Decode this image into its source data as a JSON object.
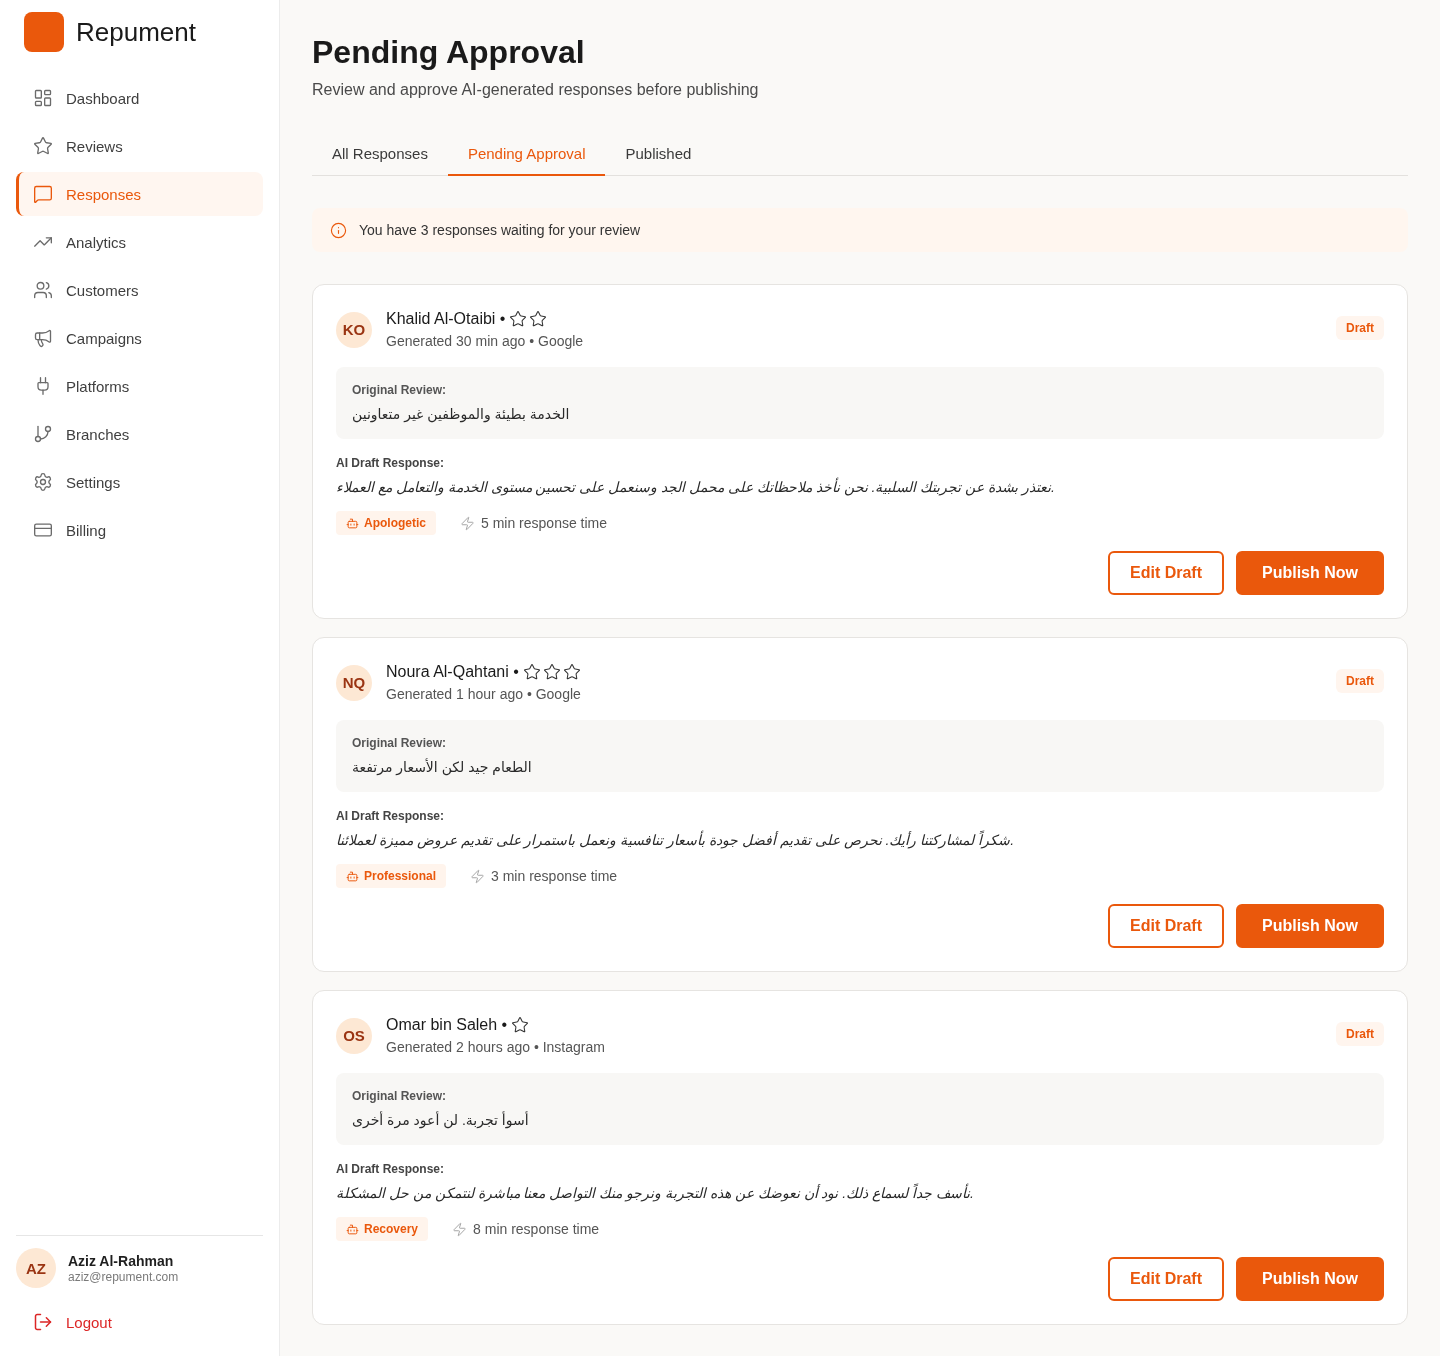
{
  "sidebar": {
    "brand": "Repument",
    "nav": [
      {
        "label": "Dashboard",
        "selected": false
      },
      {
        "label": "Reviews",
        "selected": false
      },
      {
        "label": "Responses",
        "selected": true
      },
      {
        "label": "Analytics",
        "selected": false
      },
      {
        "label": "Customers",
        "selected": false
      },
      {
        "label": "Campaigns",
        "selected": false
      },
      {
        "label": "Platforms",
        "selected": false
      },
      {
        "label": "Branches",
        "selected": false
      },
      {
        "label": "Settings",
        "selected": false
      },
      {
        "label": "Billing",
        "selected": false
      }
    ],
    "user": {
      "initials": "AZ",
      "name": "Aziz Al-Rahman",
      "email": "aziz@repument.com"
    },
    "logout": "Logout"
  },
  "page": {
    "title": "Pending Approval",
    "subtitle": "Review and approve AI-generated responses before publishing"
  },
  "tabs": [
    {
      "label": "All Responses",
      "selected": false
    },
    {
      "label": "Pending Approval",
      "selected": true
    },
    {
      "label": "Published",
      "selected": false
    }
  ],
  "notice": "You have 3 responses waiting for your review",
  "cards": [
    {
      "initials": "KO",
      "name": "Khalid Al-Otaibi •",
      "rating_stars": [
        {
          "filled": false
        },
        {
          "filled": false
        }
      ],
      "meta": "Generated 30 min ago • Google",
      "status": "Draft",
      "original_label": "Original Review:",
      "original": "الخدمة بطيئة والموظفين غير متعاونين",
      "draft_label": "AI Draft Response:",
      "draft": "نعتذر بشدة عن تجربتك السلبية. نحن نأخذ ملاحظاتك على محمل الجد وسنعمل على تحسين مستوى الخدمة والتعامل مع العملاء.",
      "tone": "Apologetic",
      "response_time": "5 min response time",
      "actions": [
        {
          "label": "Edit Draft",
          "kind": "outline"
        },
        {
          "label": "Publish Now",
          "kind": "primary"
        }
      ]
    },
    {
      "initials": "NQ",
      "name": "Noura Al-Qahtani •",
      "rating_stars": [
        {
          "filled": false
        },
        {
          "filled": false
        },
        {
          "filled": false
        }
      ],
      "meta": "Generated 1 hour ago • Google",
      "status": "Draft",
      "original_label": "Original Review:",
      "original": "الطعام جيد لكن الأسعار مرتفعة",
      "draft_label": "AI Draft Response:",
      "draft": "شكراً لمشاركتنا رأيك. نحرص على تقديم أفضل جودة بأسعار تنافسية ونعمل باستمرار على تقديم عروض مميزة لعملائنا.",
      "tone": "Professional",
      "response_time": "3 min response time",
      "actions": [
        {
          "label": "Edit Draft",
          "kind": "outline"
        },
        {
          "label": "Publish Now",
          "kind": "primary"
        }
      ]
    },
    {
      "initials": "OS",
      "name": "Omar bin Saleh •",
      "rating_stars": [
        {
          "filled": false
        }
      ],
      "meta": "Generated 2 hours ago • Instagram",
      "status": "Draft",
      "original_label": "Original Review:",
      "original": "أسوأ تجربة. لن أعود مرة أخرى",
      "draft_label": "AI Draft Response:",
      "draft": "نأسف جداً لسماع ذلك. نود أن نعوضك عن هذه التجربة ونرجو منك التواصل معنا مباشرة لنتمكن من حل المشكلة.",
      "tone": "Recovery",
      "response_time": "8 min response time",
      "actions": [
        {
          "label": "Edit Draft",
          "kind": "outline"
        },
        {
          "label": "Publish Now",
          "kind": "primary"
        }
      ]
    }
  ]
}
